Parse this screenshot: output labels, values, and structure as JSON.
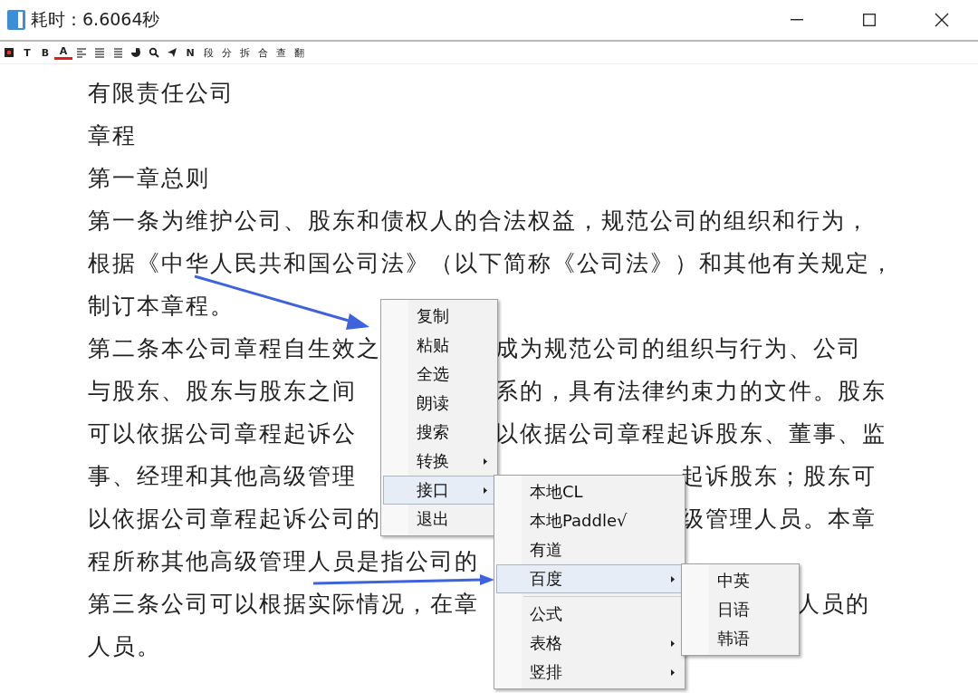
{
  "window": {
    "title": "耗时：6.6064秒"
  },
  "toolbar": [
    {
      "kind": "stop"
    },
    {
      "kind": "glyph",
      "label": "T"
    },
    {
      "kind": "glyph",
      "label": "B"
    },
    {
      "kind": "colorglyph",
      "label": "A",
      "color": "#e02020"
    },
    {
      "kind": "alignleft"
    },
    {
      "kind": "justify"
    },
    {
      "kind": "lines"
    },
    {
      "kind": "pie"
    },
    {
      "kind": "search"
    },
    {
      "kind": "send"
    },
    {
      "kind": "glyph",
      "label": "N"
    },
    {
      "kind": "word",
      "label": "段"
    },
    {
      "kind": "word",
      "label": "分"
    },
    {
      "kind": "word",
      "label": "拆"
    },
    {
      "kind": "word",
      "label": "合"
    },
    {
      "kind": "word",
      "label": "查"
    },
    {
      "kind": "word",
      "label": "翻"
    }
  ],
  "document": {
    "lines": [
      {
        "left": "有限责任公司"
      },
      {
        "left": "章程"
      },
      {
        "left": "第一章总则"
      },
      {
        "left": "第一条为维护公司、股东和债权人的合法权益，规范公司的组织和行为，"
      },
      {
        "left": "根据《中华人民共和国公司法》（以下简称《公司法》）和其他有关规定，"
      },
      {
        "left": "制订本章程。"
      },
      {
        "left": "第二条本公司章程自生效之",
        "right": "成为规范公司的组织与行为、公司"
      },
      {
        "left": "与股东、股东与股东之间",
        "right": "系的，具有法律约束力的文件。股东"
      },
      {
        "left": "可以依据公司章程起诉公",
        "right": "以依据公司章程起诉股东、董事、监"
      },
      {
        "left": "事、经理和其他高级管理",
        "right": "起诉股东；股东可"
      },
      {
        "left": "以依据公司章程起诉公司的",
        "right": "级管理人员。本章"
      },
      {
        "left": "程所称其他高级管理人员是指公司的"
      },
      {
        "left": "第三条公司可以根据实际情况，在章",
        "right": "人员的"
      },
      {
        "left": "人员。"
      }
    ]
  },
  "context_menus": [
    {
      "items": [
        {
          "label": "复制",
          "submenu": false,
          "selected": false
        },
        {
          "label": "粘贴",
          "submenu": false,
          "selected": false
        },
        {
          "label": "全选",
          "submenu": false,
          "selected": false
        },
        {
          "label": "朗读",
          "submenu": false,
          "selected": false
        },
        {
          "label": "搜索",
          "submenu": false,
          "selected": false
        },
        {
          "label": "转换",
          "submenu": true,
          "selected": false
        },
        {
          "label": "接口",
          "submenu": true,
          "selected": true
        },
        {
          "label": "退出",
          "submenu": false,
          "selected": false
        }
      ]
    },
    {
      "items": [
        {
          "label": "本地CL",
          "submenu": false,
          "selected": false
        },
        {
          "label": "本地Paddle√",
          "submenu": false,
          "selected": false
        },
        {
          "label": "有道",
          "submenu": false,
          "selected": false
        },
        {
          "label": "百度",
          "submenu": true,
          "selected": true
        },
        {
          "kind": "separator"
        },
        {
          "label": "公式",
          "submenu": false,
          "selected": false
        },
        {
          "label": "表格",
          "submenu": true,
          "selected": false
        },
        {
          "label": "竖排",
          "submenu": true,
          "selected": false
        }
      ]
    },
    {
      "items": [
        {
          "label": "中英",
          "submenu": false,
          "selected": false
        },
        {
          "label": "日语",
          "submenu": false,
          "selected": false
        },
        {
          "label": "韩语",
          "submenu": false,
          "selected": false
        }
      ]
    }
  ]
}
